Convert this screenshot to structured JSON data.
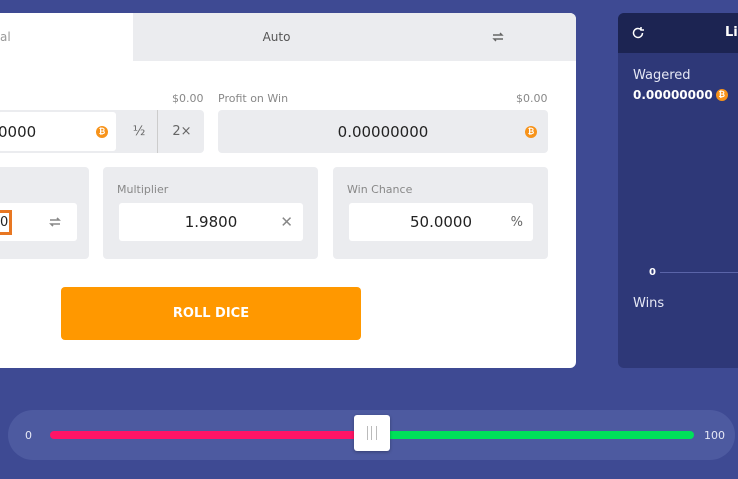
{
  "tabs": [
    {
      "label": "al"
    },
    {
      "label": "Auto"
    }
  ],
  "bet": {
    "label_value": "$0.00",
    "amount": "0000",
    "half": "½",
    "double": "2×"
  },
  "profit": {
    "label": "Profit on Win",
    "value": "$0.00",
    "amount": "0.00000000"
  },
  "multiplier": {
    "label": "Multiplier",
    "value": "1.9800"
  },
  "win_chance": {
    "label": "Win Chance",
    "value": "50.0000",
    "unit": "%"
  },
  "roll_over": {
    "value": "0"
  },
  "roll_button": "ROLL DICE",
  "live": {
    "title": "Li",
    "wagered_label": "Wagered",
    "wagered_value": "0.00000000",
    "axis_zero": "0",
    "wins_label": "Wins"
  },
  "slider": {
    "min": "0",
    "max": "100",
    "value_fraction": 0.5
  },
  "colors": {
    "accent": "#ff9800",
    "lose": "#ff1466",
    "win": "#00e05a",
    "coin": "#f7931a"
  }
}
